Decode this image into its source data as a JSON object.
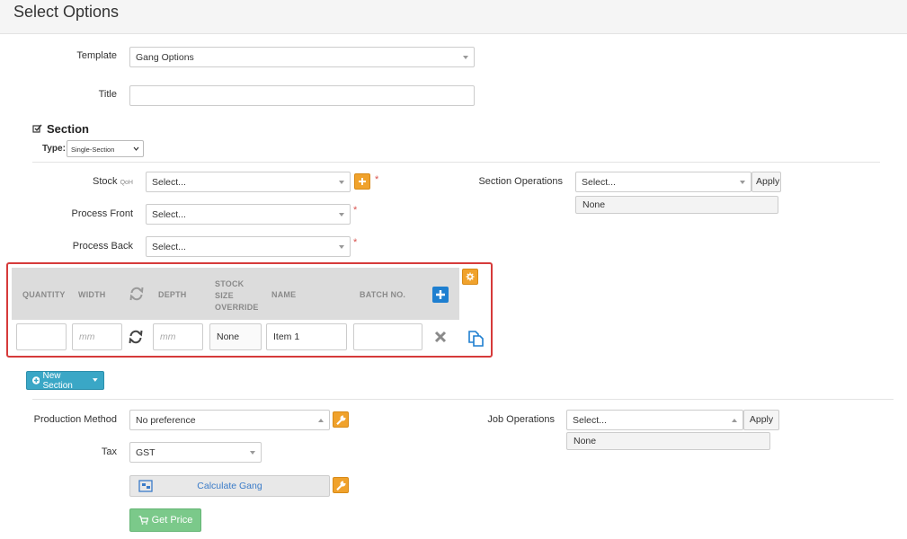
{
  "page": {
    "title": "Select Options"
  },
  "form": {
    "template_label": "Template",
    "template_value": "Gang Options",
    "title_label": "Title",
    "title_value": ""
  },
  "section": {
    "heading": "Section",
    "type_label": "Type:",
    "type_value": "Single-Section",
    "stock_label": "Stock",
    "stock_qoh": "QoH",
    "stock_value": "Select...",
    "process_front_label": "Process Front",
    "process_front_value": "Select...",
    "process_back_label": "Process Back",
    "process_back_value": "Select...",
    "required_mark": "*",
    "section_operations_label": "Section Operations",
    "section_operations_value": "Select...",
    "apply_label": "Apply",
    "section_operations_selected": "None"
  },
  "items_table": {
    "headers": {
      "quantity": "QUANTITY",
      "width": "WIDTH",
      "depth": "DEPTH",
      "stock_size_line1": "STOCK",
      "stock_size_line2": "SIZE",
      "stock_size_line3": "OVERRIDE",
      "name": "NAME",
      "batch": "BATCH NO."
    },
    "row": {
      "quantity": "",
      "width_placeholder": "mm",
      "depth_placeholder": "mm",
      "stock_size_override": "None",
      "name": "Item 1",
      "batch": ""
    }
  },
  "new_section_label": "New Section",
  "job": {
    "production_method_label": "Production Method",
    "production_method_value": "No preference",
    "tax_label": "Tax",
    "tax_value": "GST",
    "calculate_gang_label": "Calculate Gang",
    "get_price_label": "Get Price",
    "job_operations_label": "Job Operations",
    "job_operations_value": "Select...",
    "apply_label": "Apply",
    "job_operations_selected": "None"
  },
  "colors": {
    "highlight": "#d63a3a",
    "orange": "#f0a22c",
    "blue_button": "#3aa7c6",
    "green_button": "#7bc98a",
    "plus_blue": "#1e7fd0"
  }
}
